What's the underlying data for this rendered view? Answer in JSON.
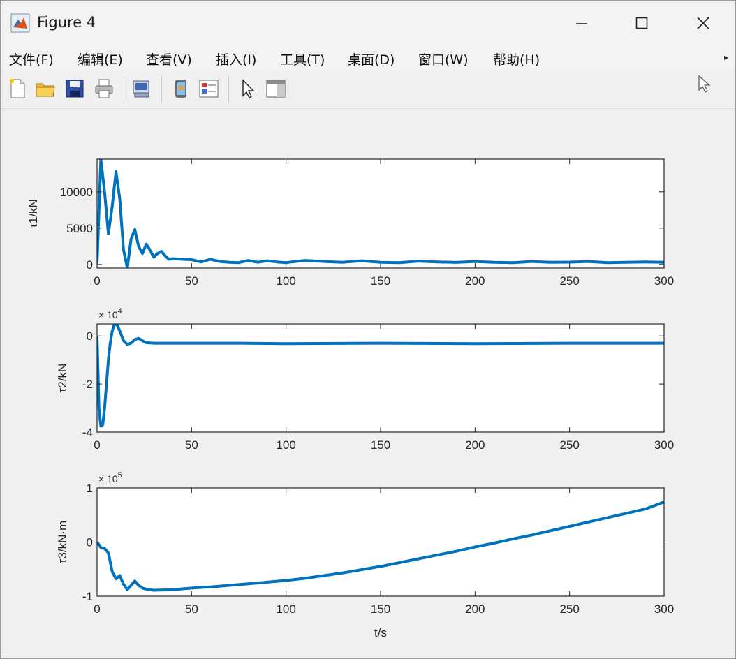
{
  "window": {
    "title": "Figure 4"
  },
  "menu": {
    "items": [
      "文件(F)",
      "编辑(E)",
      "查看(V)",
      "插入(I)",
      "工具(T)",
      "桌面(D)",
      "窗口(W)",
      "帮助(H)"
    ]
  },
  "colors": {
    "line": "#0072bd",
    "axes_bg": "#ffffff",
    "figure_bg": "#f0f0f0"
  },
  "icons": [
    "new-figure-icon",
    "open-folder-icon",
    "save-icon",
    "print-icon",
    "print-preview-icon",
    "dock-icon",
    "insert-legend-icon",
    "select-arrow-icon",
    "property-inspector-icon"
  ],
  "chart_data": [
    {
      "type": "line",
      "ylabel": "τ1/kN",
      "xlim": [
        0,
        300
      ],
      "ylim": [
        -500,
        14500
      ],
      "xticks": [
        "0",
        "50",
        "100",
        "150",
        "200",
        "250",
        "300"
      ],
      "yticks": [
        {
          "v": 0,
          "label": "0"
        },
        {
          "v": 5000,
          "label": "5000"
        },
        {
          "v": 10000,
          "label": "10000"
        }
      ],
      "exponent": "",
      "x": [
        0,
        2,
        4,
        6,
        8,
        10,
        12,
        14,
        16,
        18,
        20,
        22,
        24,
        26,
        28,
        30,
        32,
        34,
        36,
        38,
        40,
        45,
        50,
        55,
        60,
        65,
        70,
        75,
        80,
        85,
        90,
        95,
        100,
        110,
        120,
        130,
        140,
        150,
        160,
        170,
        180,
        190,
        200,
        210,
        220,
        230,
        240,
        250,
        260,
        270,
        280,
        290,
        300
      ],
      "y": [
        100,
        14500,
        10000,
        4200,
        8000,
        12800,
        9000,
        2000,
        -500,
        3500,
        4800,
        2500,
        1500,
        2800,
        2000,
        1000,
        1500,
        1800,
        1200,
        700,
        800,
        700,
        650,
        350,
        700,
        400,
        300,
        250,
        550,
        300,
        500,
        350,
        250,
        550,
        400,
        300,
        500,
        300,
        250,
        450,
        350,
        280,
        400,
        300,
        250,
        400,
        300,
        320,
        400,
        250,
        300,
        350,
        300
      ]
    },
    {
      "type": "line",
      "ylabel": "τ2/kN",
      "xlim": [
        0,
        300
      ],
      "ylim": [
        -4,
        0.5
      ],
      "xticks": [
        "0",
        "50",
        "100",
        "150",
        "200",
        "250",
        "300"
      ],
      "yticks": [
        {
          "v": 0,
          "label": "0"
        },
        {
          "v": -2,
          "label": "-2"
        },
        {
          "v": -4,
          "label": "-4"
        }
      ],
      "exponent": "× 10",
      "exponent_power": "4",
      "x": [
        0,
        1,
        2,
        3,
        4,
        5,
        6,
        7,
        8,
        9,
        10,
        11,
        12,
        14,
        16,
        18,
        20,
        22,
        24,
        26,
        30,
        40,
        50,
        75,
        100,
        150,
        200,
        250,
        300
      ],
      "y": [
        0,
        -3.0,
        -3.75,
        -3.7,
        -3.0,
        -2.0,
        -1.0,
        -0.3,
        0.2,
        0.45,
        0.5,
        0.4,
        0.2,
        -0.2,
        -0.35,
        -0.3,
        -0.15,
        -0.1,
        -0.2,
        -0.28,
        -0.3,
        -0.3,
        -0.3,
        -0.3,
        -0.32,
        -0.3,
        -0.32,
        -0.3,
        -0.3
      ]
    },
    {
      "type": "line",
      "ylabel": "τ3/kN·m",
      "xlim": [
        0,
        300
      ],
      "ylim": [
        -1,
        1
      ],
      "xticks": [
        "0",
        "50",
        "100",
        "150",
        "200",
        "250",
        "300"
      ],
      "yticks": [
        {
          "v": 1,
          "label": "1"
        },
        {
          "v": 0,
          "label": "0"
        },
        {
          "v": -1,
          "label": "-1"
        }
      ],
      "exponent": "× 10",
      "exponent_power": "5",
      "x": [
        0,
        2,
        4,
        6,
        8,
        10,
        12,
        14,
        16,
        18,
        20,
        22,
        24,
        26,
        30,
        40,
        50,
        60,
        70,
        80,
        90,
        100,
        110,
        120,
        130,
        140,
        150,
        160,
        170,
        180,
        190,
        200,
        210,
        220,
        230,
        240,
        250,
        260,
        270,
        280,
        290,
        300
      ],
      "y": [
        0,
        -0.1,
        -0.12,
        -0.2,
        -0.55,
        -0.68,
        -0.62,
        -0.78,
        -0.88,
        -0.8,
        -0.72,
        -0.8,
        -0.85,
        -0.87,
        -0.89,
        -0.88,
        -0.85,
        -0.83,
        -0.8,
        -0.77,
        -0.74,
        -0.71,
        -0.67,
        -0.62,
        -0.57,
        -0.51,
        -0.45,
        -0.38,
        -0.31,
        -0.24,
        -0.17,
        -0.09,
        -0.02,
        0.06,
        0.13,
        0.21,
        0.29,
        0.37,
        0.45,
        0.53,
        0.61,
        0.74
      ]
    }
  ],
  "xlabel": "t/s"
}
